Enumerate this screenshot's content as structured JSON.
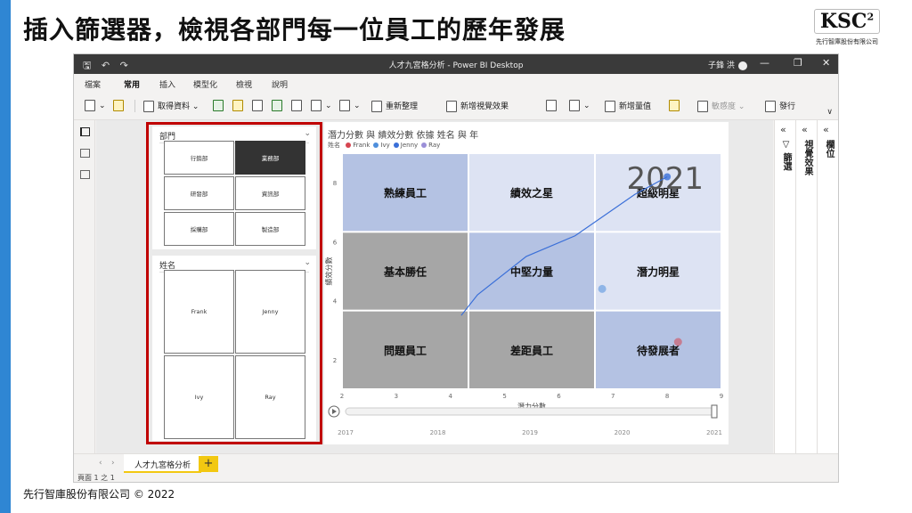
{
  "slide": {
    "title": "插入篩選器，檢視各部門每一位員工的歷年發展",
    "logo": {
      "text": "KSC",
      "sup": "2",
      "subtitle": "先行智庫股份有限公司"
    },
    "footer": "先行智庫股份有限公司 © 2022"
  },
  "window": {
    "title": "人才九宮格分析 - Power BI Desktop",
    "user": "子鋒 洪",
    "quick_access": {
      "save": "🖫",
      "undo": "↶",
      "redo": "↷"
    },
    "controls": {
      "minimize": "—",
      "restore": "❐",
      "close": "✕"
    }
  },
  "menu": {
    "items": [
      "檔案",
      "常用",
      "插入",
      "模型化",
      "檢視",
      "說明"
    ],
    "active": "常用"
  },
  "ribbon": {
    "get_data": "取得資料",
    "refresh": "重新整理",
    "new_visual": "新增視覺效果",
    "new_measure": "新增量值",
    "sensitivity": "敏感度",
    "publish": "發行",
    "collapse": "∨"
  },
  "panels": {
    "filters": "篩選",
    "visualizations": "視覺效果",
    "fields": "欄位",
    "expand_icon": "«"
  },
  "page_tabs": {
    "tab": "人才九宮格分析",
    "add": "+",
    "prev": "‹",
    "next": "›"
  },
  "status": {
    "page": "頁面 1 之 1"
  },
  "slicer_dept": {
    "header": "部門",
    "chevron": "⌄",
    "items": [
      "行銷部",
      "業務部",
      "研發部",
      "資訊部",
      "採購部",
      "製造部"
    ],
    "selected": "業務部"
  },
  "slicer_name": {
    "header": "姓名",
    "chevron": "⌄",
    "items": [
      "Frank",
      "Jenny",
      "Ivy",
      "Ray"
    ]
  },
  "chart_data": {
    "type": "scatter",
    "title": "潛力分數 與 績效分數 依據 姓名 與 年",
    "legend_title": "姓名",
    "series": [
      {
        "name": "Frank",
        "color": "#d64550"
      },
      {
        "name": "Ivy",
        "color": "#4e8fdc"
      },
      {
        "name": "Jenny",
        "color": "#3a6fd8"
      },
      {
        "name": "Ray",
        "color": "#9b8fd8"
      }
    ],
    "xlabel": "潛力分數",
    "ylabel": "績效分數",
    "xlim": [
      2,
      9
    ],
    "ylim": [
      1,
      9
    ],
    "xticks": [
      2,
      3,
      4,
      5,
      6,
      7,
      8,
      9
    ],
    "yticks": [
      2,
      4,
      6,
      8
    ],
    "play_axis": {
      "label": "年",
      "ticks": [
        "2017",
        "2018",
        "2019",
        "2020",
        "2021"
      ],
      "current": "2021",
      "play_icon": "▷"
    },
    "grid_labels": [
      [
        "熟練員工",
        "績效之星",
        "超級明星"
      ],
      [
        "基本勝任",
        "中堅力量",
        "潛力明星"
      ],
      [
        "問題員工",
        "差距員工",
        "待發展者"
      ]
    ],
    "grid_colors": [
      [
        "#b4c2e3",
        "#dde3f3",
        "#dde3f3"
      ],
      [
        "#a6a6a6",
        "#b4c2e3",
        "#dde3f3"
      ],
      [
        "#a6a6a6",
        "#a6a6a6",
        "#b4c2e3"
      ]
    ],
    "trail": {
      "series": "Jenny",
      "x": [
        4.2,
        4.5,
        5.4,
        6.3,
        7.4,
        8.0
      ],
      "y": [
        3.5,
        4.2,
        5.5,
        6.2,
        7.6,
        8.2
      ]
    },
    "points": [
      {
        "series": "Ivy",
        "x": 6.8,
        "y": 4.4
      },
      {
        "series": "Frank",
        "x": 8.2,
        "y": 2.6
      }
    ]
  }
}
